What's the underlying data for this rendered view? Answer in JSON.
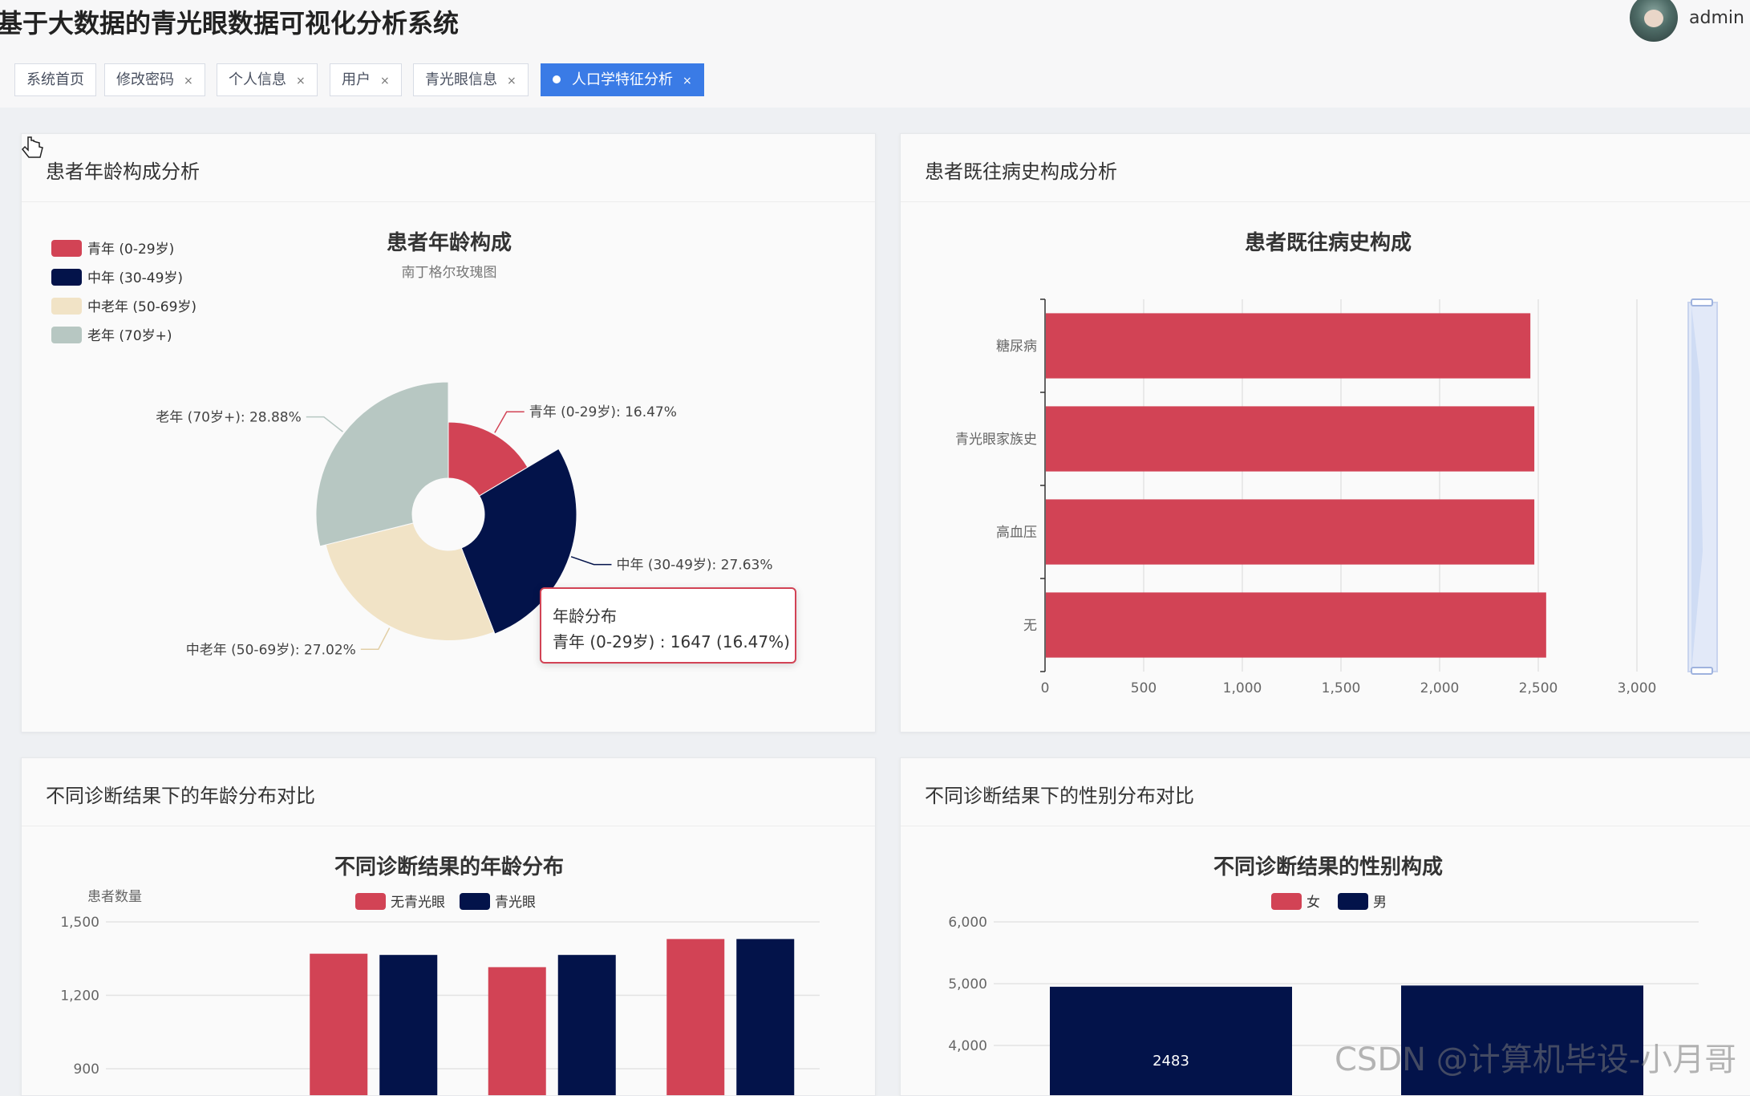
{
  "header": {
    "app_title": "基于大数据的青光眼数据可视化分析系统",
    "username": "admin"
  },
  "tabs": [
    {
      "label": "系统首页",
      "closable": false,
      "active": false
    },
    {
      "label": "修改密码",
      "closable": true,
      "active": false
    },
    {
      "label": "个人信息",
      "closable": true,
      "active": false
    },
    {
      "label": "用户",
      "closable": true,
      "active": false
    },
    {
      "label": "青光眼信息",
      "closable": true,
      "active": false
    },
    {
      "label": "人口学特征分析",
      "closable": true,
      "active": true
    }
  ],
  "tab_close_glyph": "×",
  "colors": {
    "red": "#d24355",
    "navy": "#03134a",
    "cream": "#f1e3c6",
    "sage": "#b7c7c2",
    "active_tab": "#3a7be6"
  },
  "cards": {
    "age": {
      "title": "患者年龄构成分析"
    },
    "history": {
      "title": "患者既往病史构成分析"
    },
    "diag_age": {
      "title": "不同诊断结果下的年龄分布对比"
    },
    "diag_gender": {
      "title": "不同诊断结果下的性别分布对比"
    }
  },
  "tooltip": {
    "title": "年龄分布",
    "line": "青年 (0-29岁) : 1647 (16.47%)"
  },
  "watermark": "CSDN @计算机毕设-小月哥",
  "chart_data": [
    {
      "type": "pie",
      "subtype": "nightingale-rose",
      "title": "患者年龄构成",
      "subtitle": "南丁格尔玫瑰图",
      "legend_position": "top-left",
      "categories": [
        "青年 (0-29岁)",
        "中年 (30-49岁)",
        "中老年 (50-69岁)",
        "老年 (70岁+)"
      ],
      "values": [
        1647,
        2763,
        2702,
        2888
      ],
      "labels": [
        "青年 (0-29岁): 16.47%",
        "中年 (30-49岁): 27.63%",
        "中老年 (50-69岁): 27.02%",
        "老年 (70岁+): 28.88%"
      ],
      "colors": [
        "#d24355",
        "#03134a",
        "#f1e3c6",
        "#b7c7c2"
      ]
    },
    {
      "type": "bar",
      "orientation": "horizontal",
      "title": "患者既往病史构成",
      "categories": [
        "糖尿病",
        "青光眼家族史",
        "高血压",
        "无"
      ],
      "values": [
        2460,
        2480,
        2480,
        2540
      ],
      "xlim": [
        0,
        3000
      ],
      "xticks": [
        "0",
        "500",
        "1,000",
        "1,500",
        "2,000",
        "2,500",
        "3,000"
      ],
      "color": "#d24355",
      "grid": true,
      "datazoom_slider": true
    },
    {
      "type": "bar",
      "title": "不同诊断结果的年龄分布",
      "ylabel": "患者数量",
      "yticks": [
        "900",
        "1,200",
        "1,500"
      ],
      "ylim_visible": [
        900,
        1500
      ],
      "legend_position": "top-center",
      "series": [
        {
          "name": "无青光眼",
          "color": "#d24355",
          "values": [
            1370,
            1315,
            1430
          ]
        },
        {
          "name": "青光眼",
          "color": "#03134a",
          "values": [
            1365,
            1365,
            1430
          ]
        }
      ]
    },
    {
      "type": "bar",
      "title": "不同诊断结果的性别构成",
      "yticks": [
        "4,000",
        "5,000",
        "6,000"
      ],
      "ylim_visible": [
        4000,
        6000
      ],
      "legend_position": "top-center",
      "series": [
        {
          "name": "女",
          "color": "#d24355",
          "values": [
            null,
            null
          ]
        },
        {
          "name": "男",
          "color": "#03134a",
          "values": [
            4950,
            4970
          ]
        }
      ],
      "data_labels": [
        "2483"
      ]
    }
  ]
}
